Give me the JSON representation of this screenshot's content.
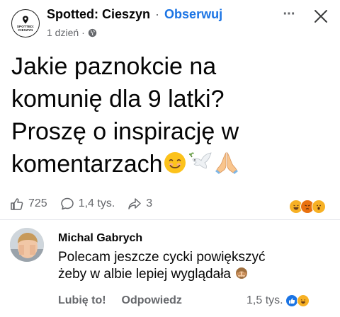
{
  "header": {
    "page_name": "Spotted: Cieszyn",
    "separator": "·",
    "follow_label": "Obserwuj",
    "time": "1 dzień",
    "meta_sep": "·",
    "avatar_line1": "SPOTTED:",
    "avatar_line2": "CIESZYN",
    "more_label": "···"
  },
  "post": {
    "line1": "Jakie paznokcie na",
    "line2": "komunię dla 9 latki?",
    "line3": "Proszę o inspirację w",
    "line4": "komentarzach",
    "emojis": [
      "smiling-face",
      "dove",
      "folded-hands"
    ]
  },
  "stats": {
    "likes": "725",
    "comments": "1,4 tys.",
    "shares": "3"
  },
  "comment": {
    "author": "Michal Gabrych",
    "line1": "Polecam jeszcze cycki powiększyć",
    "line2": "żeby w albie lepiej wyglądała",
    "like_label": "Lubię to!",
    "reply_label": "Odpowiedz",
    "reaction_count": "1,5 tys."
  },
  "colors": {
    "accent": "#1b74e4",
    "muted": "#65676b",
    "text": "#050505"
  }
}
